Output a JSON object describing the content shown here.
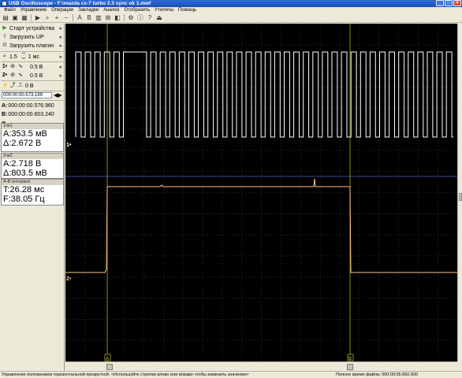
{
  "window": {
    "title": "USB Oscilloscope - F:\\mazda cx-7 turbo 2.3 sync ok 1.mwf",
    "controls": [
      "_",
      "□",
      "×"
    ]
  },
  "menu": [
    "Файл",
    "Управление",
    "Операции",
    "Закладки",
    "Анализ",
    "Отобразить",
    "Утилиты",
    "Помощь"
  ],
  "toolbar_icons": [
    "open-icon",
    "save-icon",
    "print-icon",
    "run-icon",
    "zoom-icon",
    "zoom-in-icon",
    "zoom-out-icon",
    "cursor-a-icon",
    "cursor-b-icon",
    "grid-icon",
    "measure-icon",
    "marker-icon",
    "settings-icon",
    "info-icon",
    "help-icon",
    "exit-icon"
  ],
  "toolbar_glyphs": [
    "▤",
    "▣",
    "▦",
    "▶",
    "⌕",
    "+",
    "−",
    "A",
    "B",
    "▥",
    "⊞",
    "◧",
    "⚙",
    "ⓘ",
    "?",
    "⏏"
  ],
  "left_panel": {
    "start_device": "Старт устройства",
    "load_up": "Загрузить UP",
    "load_plugin": "Загрузить плагин",
    "time_scale": "1.5",
    "time_div": "1 мс",
    "ch1_volts": "0.5 В",
    "ch2_volts": "0.5 В",
    "trigger_level": "0 В",
    "time_position": "000:00:00.573.199",
    "cursor_a_label": "A:",
    "cursor_a_time": "000:00:00.576.960",
    "cursor_b_label": "B:",
    "cursor_b_time": "000:00:00.603.240",
    "phi_label": "φ",
    "phi_value": "...",
    "ch1_header": "1•ж1",
    "ch1_a": "A:353.5 мВ",
    "ch1_delta": "Δ:2.672 В",
    "ch2_header": "2•ж2",
    "ch2_a": "A:2.718 В",
    "ch2_delta": "Δ:803.5 мВ",
    "interval_header": "A-B интервал",
    "interval_t": "T:26.28 мс",
    "interval_f": "F:38.05 Гц"
  },
  "scope": {
    "ch1_marker": "1•",
    "ch2_marker": "2•",
    "cursor_a": "A",
    "cursor_b": "B",
    "colors": {
      "background": "#000000",
      "grid": "#4a4a4a",
      "ch1": "#ffffff",
      "ch2": "#ffc28a",
      "cursor": "#8a8a20",
      "divider": "#3a4a9a"
    }
  },
  "status": {
    "left": "Управление положением горизонтальной прокруткой.  <Используйте стрелки влево или вправо чтобы изменить значение>",
    "right": "Полное время файла: 000:00:05.650.600"
  }
}
